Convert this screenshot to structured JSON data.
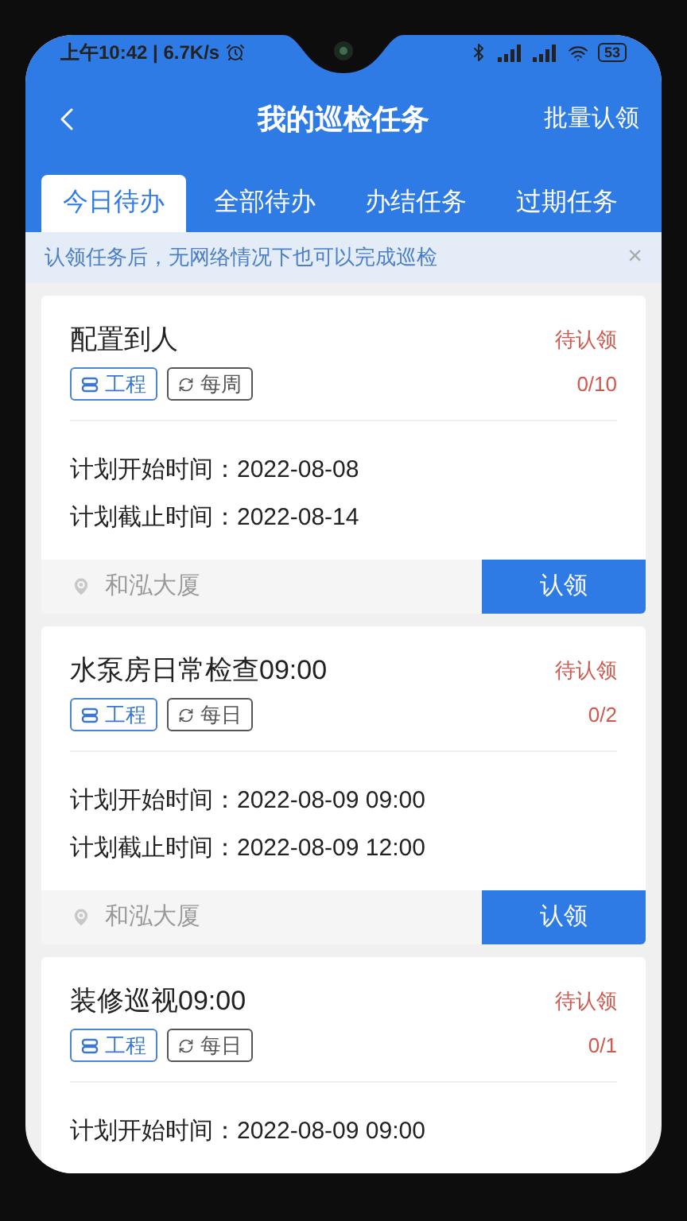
{
  "status_bar": {
    "time": "上午10:42 | 6.7K/s",
    "battery": "53"
  },
  "header": {
    "title": "我的巡检任务",
    "action": "批量认领"
  },
  "tabs": [
    {
      "label": "今日待办",
      "selected": true
    },
    {
      "label": "全部待办",
      "selected": false
    },
    {
      "label": "办结任务",
      "selected": false
    },
    {
      "label": "过期任务",
      "selected": false
    }
  ],
  "notice": {
    "text": "认领任务后，无网络情况下也可以完成巡检",
    "close": "×"
  },
  "tasks": [
    {
      "title": "配置到人",
      "status": "待认领",
      "progress": "0/10",
      "tags": [
        {
          "kind": "category",
          "label": "工程"
        },
        {
          "kind": "cycle",
          "label": "每周"
        }
      ],
      "start": "计划开始时间：2022-08-08",
      "end": "计划截止时间：2022-08-14",
      "location": "和泓大厦",
      "action": "认领"
    },
    {
      "title": "水泵房日常检查09:00",
      "status": "待认领",
      "progress": "0/2",
      "tags": [
        {
          "kind": "category",
          "label": "工程"
        },
        {
          "kind": "cycle",
          "label": "每日"
        }
      ],
      "start": "计划开始时间：2022-08-09 09:00",
      "end": "计划截止时间：2022-08-09 12:00",
      "location": "和泓大厦",
      "action": "认领"
    },
    {
      "title": "装修巡视09:00",
      "status": "待认领",
      "progress": "0/1",
      "tags": [
        {
          "kind": "category",
          "label": "工程"
        },
        {
          "kind": "cycle",
          "label": "每日"
        }
      ],
      "start": "计划开始时间：2022-08-09 09:00"
    }
  ]
}
